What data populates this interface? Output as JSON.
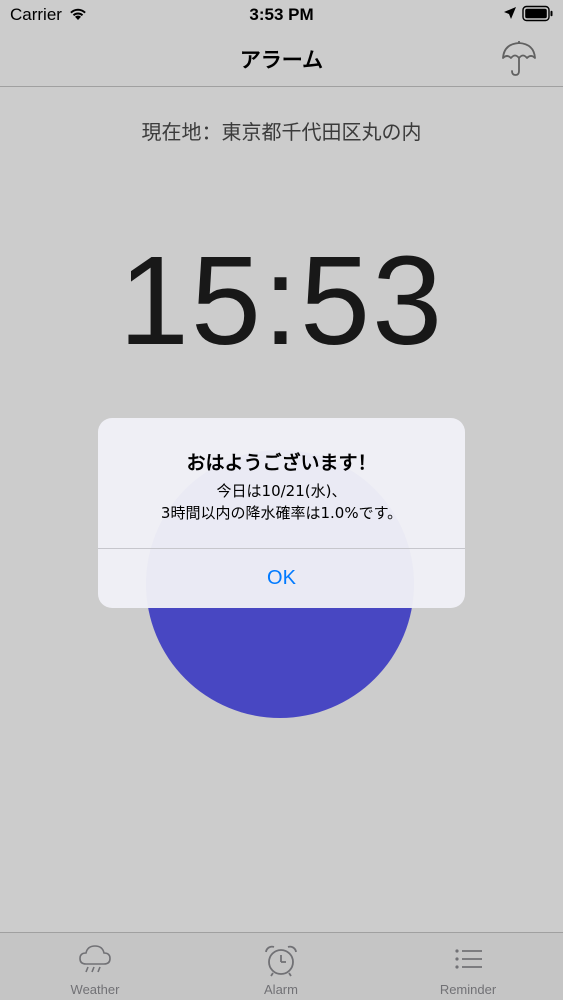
{
  "status_bar": {
    "carrier": "Carrier",
    "time": "3:53 PM"
  },
  "nav": {
    "title": "アラーム",
    "right_icon": "umbrella-icon"
  },
  "main": {
    "location_text": "現在地：東京都千代田区丸の内",
    "clock": "15:53",
    "alarm_button_color": "#5b59f3"
  },
  "alert": {
    "title": "おはようございます！",
    "message_line1": "今日は10/21(水)、",
    "message_line2": "3時間以内の降水確率は1.0%です。",
    "ok_label": "OK",
    "accent_color": "#007aff"
  },
  "tab_bar": {
    "items": [
      {
        "label": "Weather",
        "icon": "cloud-rain-icon"
      },
      {
        "label": "Alarm",
        "icon": "alarm-clock-icon"
      },
      {
        "label": "Reminder",
        "icon": "list-icon"
      }
    ]
  }
}
